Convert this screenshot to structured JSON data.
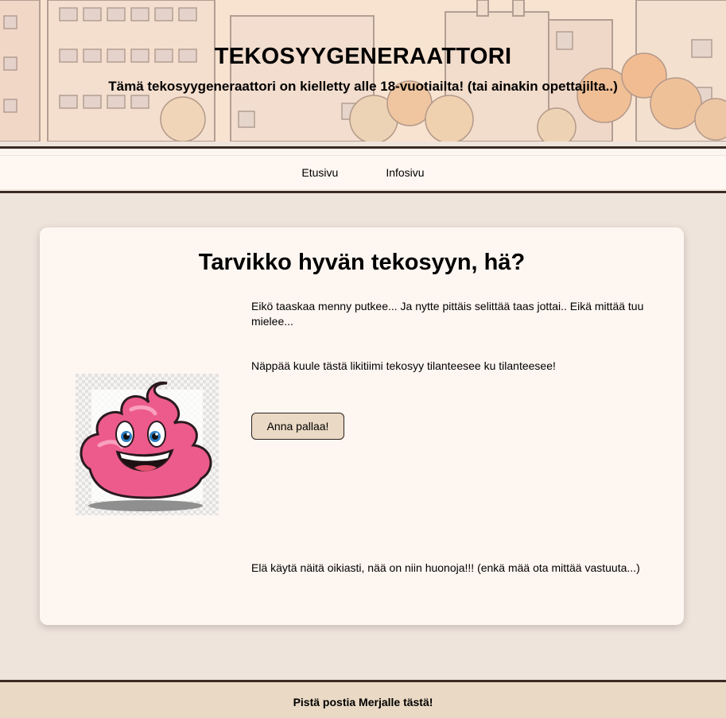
{
  "header": {
    "title": "TEKOSYYGENERAATTORI",
    "subtitle": "Tämä tekosyygeneraattori on kielletty alle 18-vuotiailta! (tai ainakin opettajilta..)"
  },
  "nav": {
    "items": [
      {
        "label": "Etusivu"
      },
      {
        "label": "Infosivu"
      }
    ]
  },
  "main": {
    "heading": "Tarvikko hyvän tekosyyn, hä?",
    "intro": "Eikö taaskaa menny putkee... Ja nytte pittäis selittää taas jottai.. Eikä mittää tuu mielee...",
    "instruction": "Näppää kuule tästä likitiimi tekosyy tilanteesee ku tilanteesee!",
    "button_label": "Anna pallaa!",
    "disclaimer": "Elä käytä näitä oikiasti, nää on niin huonoja!!! (enkä mää ota mittää vastuuta...)",
    "image": "smiling-pink-poop-mascot"
  },
  "footer": {
    "link": "Pistä postia Merjalle tästä!"
  },
  "colors": {
    "background": "#efe4dc",
    "card": "#fef6f1",
    "button": "#ead9c4",
    "border": "#3c2a24",
    "mascot_pink": "#ee5a8c"
  }
}
